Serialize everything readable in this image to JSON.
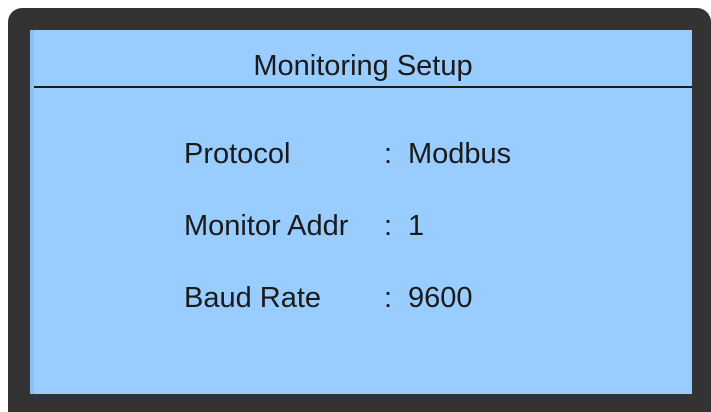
{
  "screen": {
    "title": "Monitoring Setup",
    "fields": [
      {
        "label": "Protocol",
        "separator": ":",
        "value": "Modbus"
      },
      {
        "label": "Monitor Addr",
        "separator": ":",
        "value": "1"
      },
      {
        "label": "Baud Rate",
        "separator": ":",
        "value": "9600"
      }
    ]
  },
  "colors": {
    "bezel": "#333333",
    "screen_background": "#99ccff",
    "text": "#1a1a1a"
  }
}
